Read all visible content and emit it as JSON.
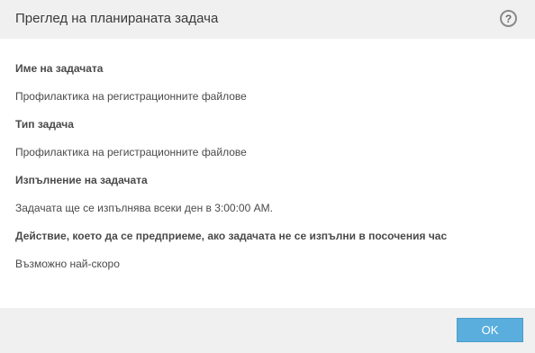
{
  "dialog": {
    "title": "Преглед на планираната задача",
    "help_glyph": "?"
  },
  "fields": [
    {
      "label": "Име на задачата",
      "value": "Профилактика на регистрационните файлове"
    },
    {
      "label": "Тип задача",
      "value": "Профилактика на регистрационните файлове"
    },
    {
      "label": "Изпълнение на задачата",
      "value": "Задачата ще се изпълнява всеки ден в 3:00:00 AM."
    },
    {
      "label": "Действие, което да се предприеме, ако задачата не се изпълни в посочения час",
      "value": "Възможно най-скоро"
    }
  ],
  "footer": {
    "ok_label": "OK"
  },
  "colors": {
    "header_bg": "#f0f0f0",
    "footer_bg": "#f0f0f0",
    "button_bg": "#5aaedd",
    "text": "#4a4a4a"
  },
  "icons": {
    "help": "help-circle-icon"
  }
}
